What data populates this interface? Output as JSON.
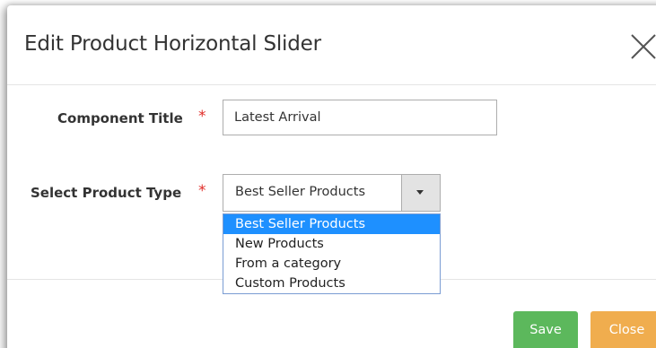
{
  "dialog": {
    "title": "Edit Product Horizontal Slider"
  },
  "form": {
    "component_title": {
      "label": "Component Title",
      "required_mark": "*",
      "value": "Latest Arrival"
    },
    "product_type": {
      "label": "Select Product Type",
      "required_mark": "*",
      "selected": "Best Seller Products",
      "options": [
        "Best Seller Products",
        "New Products",
        "From a category",
        "Custom Products"
      ]
    }
  },
  "footer": {
    "save_label": "Save",
    "close_label": "Close"
  },
  "colors": {
    "save_button": "#5cb85c",
    "close_button": "#f0ad4e",
    "required_mark": "#e02b27",
    "selected_option": "#1e90ff"
  },
  "icons": {
    "close": "close-icon",
    "dropdown": "chevron-down-icon"
  }
}
